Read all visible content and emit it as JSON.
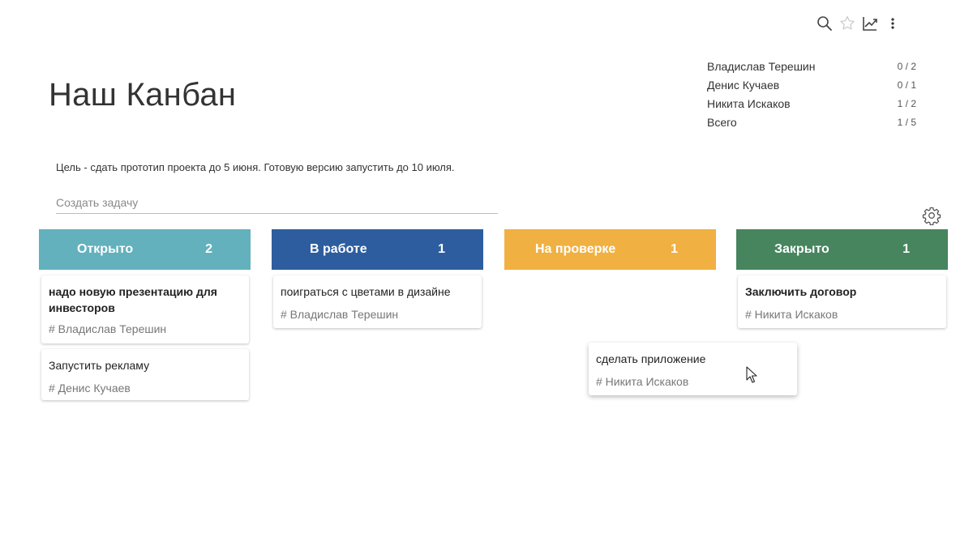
{
  "toolbar": {
    "icons": [
      "search-icon",
      "star-icon",
      "chart-icon",
      "more-vert-icon"
    ]
  },
  "board": {
    "title": "Наш Канбан",
    "goal": "Цель - сдать прототип проекта до 5 июня. Готовую версию запустить до 10 июля."
  },
  "stats": [
    {
      "name": "Владислав Терешин",
      "value": "0 / 2"
    },
    {
      "name": "Денис Кучаев",
      "value": "0 / 1"
    },
    {
      "name": "Никита Искаков",
      "value": "1 / 2"
    },
    {
      "name": "Всего",
      "value": "1 / 5"
    }
  ],
  "create_task": {
    "placeholder": "Создать задачу",
    "value": ""
  },
  "columns": [
    {
      "title": "Открыто",
      "count": "2",
      "color": "#62b1bd",
      "cards": [
        {
          "title": "надо новую презентацию для инвесторов",
          "tag": "# Владислав Терешин"
        },
        {
          "title": "Запустить рекламу",
          "tag": "# Денис Кучаев"
        }
      ]
    },
    {
      "title": "В работе",
      "count": "1",
      "color": "#2d5d9f",
      "cards": [
        {
          "title": "поиграться с цветами в дизайне",
          "tag": "# Владислав Терешин"
        }
      ]
    },
    {
      "title": "На проверке",
      "count": "1",
      "color": "#f1b042",
      "cards": []
    },
    {
      "title": "Закрыто",
      "count": "1",
      "color": "#47855f",
      "cards": [
        {
          "title": "Заключить договор",
          "tag": "# Никита Искаков"
        }
      ]
    }
  ],
  "dragging_card": {
    "title": "сделать приложение",
    "tag": "# Никита Искаков"
  }
}
